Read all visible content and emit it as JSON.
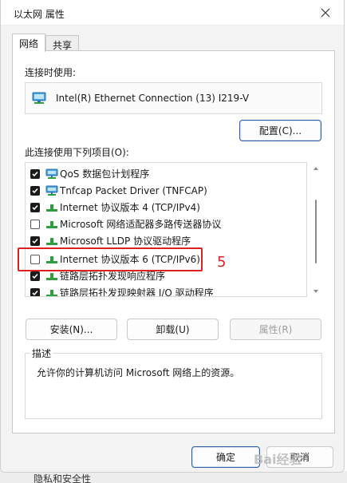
{
  "window": {
    "title": "以太网 属性"
  },
  "tabs": [
    {
      "label": "网络",
      "active": true
    },
    {
      "label": "共享",
      "active": false
    }
  ],
  "connect_using": {
    "label": "连接时使用:",
    "adapter_name": "Intel(R) Ethernet Connection (13) I219-V",
    "configure_label": "配置(C)..."
  },
  "items_section": {
    "label": "此连接使用下列项目(O):",
    "items": [
      {
        "label": "QoS 数据包计划程序",
        "checked": true,
        "icon": "network-client-icon"
      },
      {
        "label": "Tnfcap Packet Driver (TNFCAP)",
        "checked": true,
        "icon": "network-client-icon"
      },
      {
        "label": "Internet 协议版本 4 (TCP/IPv4)",
        "checked": true,
        "icon": "protocol-icon"
      },
      {
        "label": "Microsoft 网络适配器多路传送器协议",
        "checked": false,
        "icon": "protocol-icon"
      },
      {
        "label": "Microsoft LLDP 协议驱动程序",
        "checked": true,
        "icon": "protocol-icon"
      },
      {
        "label": "Internet 协议版本 6 (TCP/IPv6)",
        "checked": false,
        "icon": "protocol-icon"
      },
      {
        "label": "链路层拓扑发现响应程序",
        "checked": true,
        "icon": "protocol-icon"
      },
      {
        "label": "链路层拓扑发现映射器 I/O 驱动程序",
        "checked": true,
        "icon": "protocol-icon"
      }
    ]
  },
  "buttons": {
    "install": "安装(N)...",
    "uninstall": "卸载(U)",
    "properties": "属性(R)",
    "ok": "确定",
    "cancel": "取消"
  },
  "description": {
    "title": "描述",
    "text": "允许你的计算机访问 Microsoft 网络上的资源。"
  },
  "annotation": {
    "step": "5",
    "color": "#e02020"
  },
  "background": {
    "partial_text": "隐私和安全性"
  },
  "watermark": "Bai经验",
  "colors": {
    "accent": "#2f5ea8",
    "protocol_green": "#2e9e3e",
    "highlight_red": "#e02020"
  }
}
